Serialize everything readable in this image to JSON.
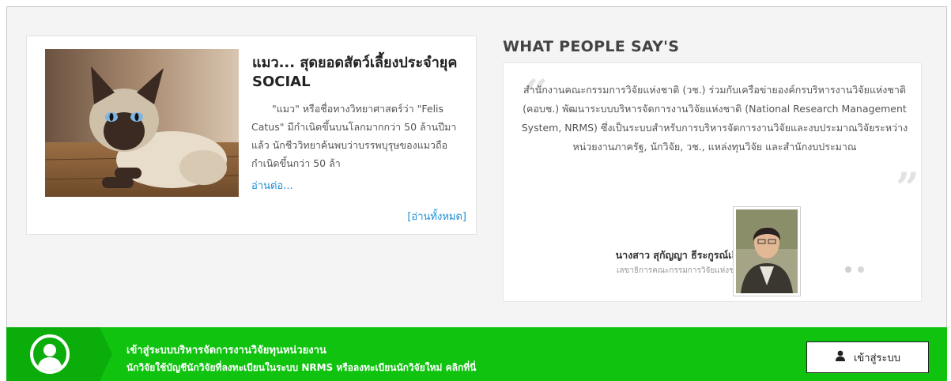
{
  "news": {
    "title": "แมว... สุดยอดสัตว์เลี้ยงประจำยุค SOCIAL",
    "excerpt": "\"แมว\" หรือชื่อทางวิทยาศาสตร์ว่า \"Felis Catus\" มีกำเนิดขึ้นบนโลกมากกว่า 50 ล้านปีมาแล้ว นักชีววิทยาค้นพบว่าบรรพบุรุษของแมวถือกำเนิดขึ้นกว่า 50 ล้า",
    "read_more": "อ่านต่อ...",
    "read_all": "[อ่านทั้งหมด]",
    "image_icon": "cat-photo"
  },
  "testimonials": {
    "heading": "WHAT PEOPLE SAY'S",
    "quote_open": "“",
    "quote_close": "”",
    "text": "สำนักงานคณะกรรมการวิจัยแห่งชาติ (วช.) ร่วมกับเครือข่ายองค์กรบริหารงานวิจัยแห่งชาติ (คอบช.) พัฒนาระบบบริหารจัดการงานวิจัยแห่งชาติ (National Research Management System, NRMS) ซึ่งเป็นระบบสำหรับการบริหารจัดการงานวิจัยและงบประมาณวิจัยระหว่างหน่วยงานภาครัฐ, นักวิจัย, วช., แหล่งทุนวิจัย และสำนักงบประมาณ",
    "person_name": "นางสาว สุกัญญา ธีระกูรณ์เลิศ",
    "person_role": "เลขาธิการคณะกรรมการวิจัยแห่งชาติ",
    "photo_icon": "person-photo",
    "active_dot": 0
  },
  "login_bar": {
    "line1": "เข้าสู่ระบบบริหารจัดการงานวิจัยทุนหน่วยงาน",
    "line2": "นักวิจัยใช้บัญชีนักวิจัยที่ลงทะเบียนในระบบ NRMS หรือลงทะเบียนนักวิจัยใหม่ คลิกที่นี่",
    "button_label": "เข้าสู่ระบบ",
    "avatar_icon": "user-avatar-icon",
    "button_icon": "user-icon",
    "colors": {
      "bar": "#0fc30f",
      "bar_dark": "#0aad0a"
    }
  }
}
